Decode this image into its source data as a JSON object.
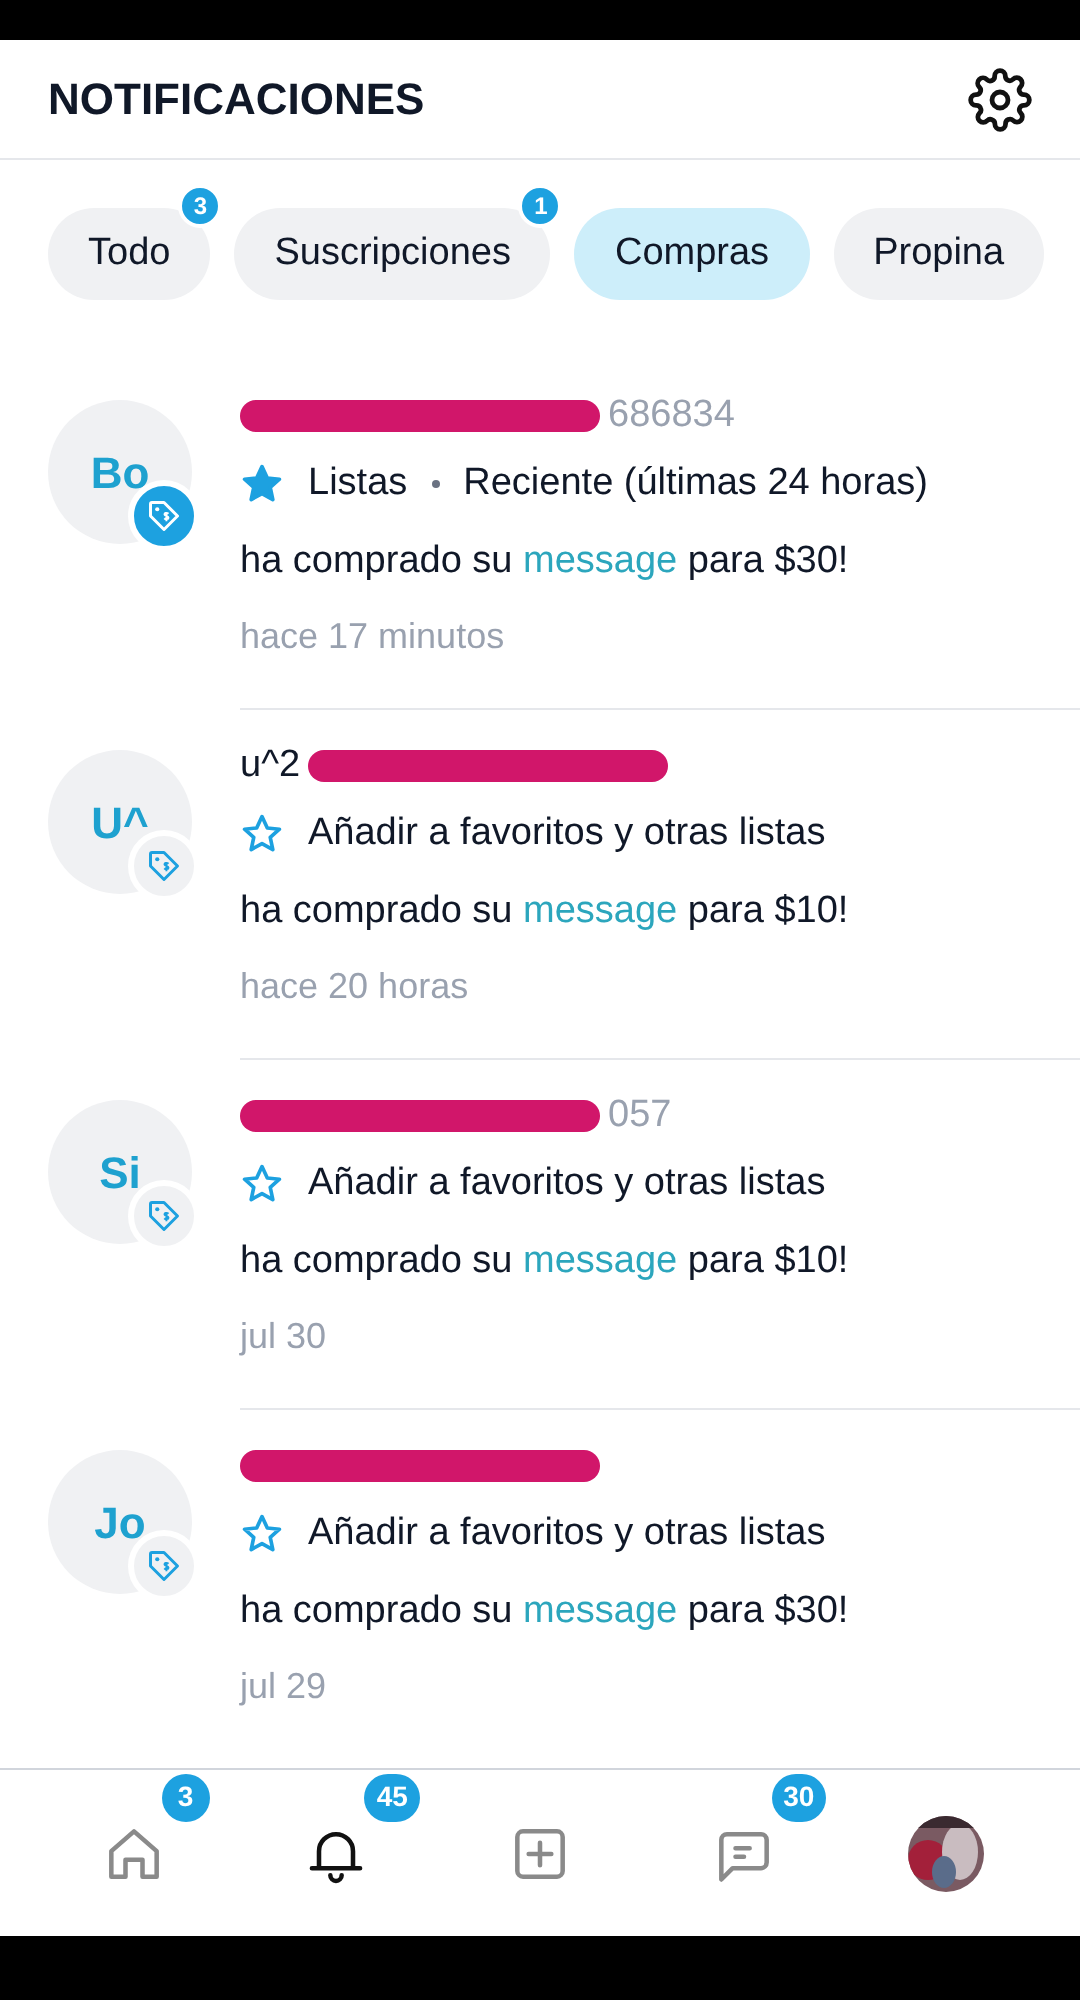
{
  "header": {
    "title": "NOTIFICACIONES"
  },
  "tabs": [
    {
      "label": "Todo",
      "badge": "3",
      "selected": false
    },
    {
      "label": "Suscripciones",
      "badge": "1",
      "selected": false
    },
    {
      "label": "Compras",
      "selected": true
    },
    {
      "label": "Propina",
      "selected": false
    }
  ],
  "notifications": [
    {
      "initials": "Bo",
      "tag_filled": true,
      "handle_part_after_mark": "686834",
      "star_filled": true,
      "lists": [
        "Listas",
        "Reciente (últimas 24 horas)"
      ],
      "message": {
        "prefix": "ha comprado su",
        "link": "message",
        "suffix": "para $30!"
      },
      "time": "hace 17 minutos"
    },
    {
      "initials": "U^",
      "tag_filled": false,
      "name_part_before_mark": "u^2",
      "star_filled": false,
      "lists": [
        "Añadir a favoritos y otras listas"
      ],
      "message": {
        "prefix": "ha comprado su",
        "link": "message",
        "suffix": "para $10!"
      },
      "time": "hace 20 horas"
    },
    {
      "initials": "Si",
      "tag_filled": false,
      "handle_part_after_mark": "057",
      "star_filled": false,
      "lists": [
        "Añadir a favoritos y otras listas"
      ],
      "message": {
        "prefix": "ha comprado su",
        "link": "message",
        "suffix": "para $10!"
      },
      "time": "jul 30"
    },
    {
      "initials": "Jo",
      "tag_filled": false,
      "star_filled": false,
      "lists": [
        "Añadir a favoritos y otras listas"
      ],
      "message": {
        "prefix": "ha comprado su",
        "link": "message",
        "suffix": "para $30!"
      },
      "time": "jul 29"
    }
  ],
  "nav": [
    {
      "kind": "home",
      "badge": "3",
      "selected": false
    },
    {
      "kind": "bell",
      "badge": "45",
      "selected": true
    },
    {
      "kind": "add",
      "selected": false
    },
    {
      "kind": "chat",
      "badge": "30",
      "selected": false
    },
    {
      "kind": "avatar",
      "selected": false
    }
  ]
}
